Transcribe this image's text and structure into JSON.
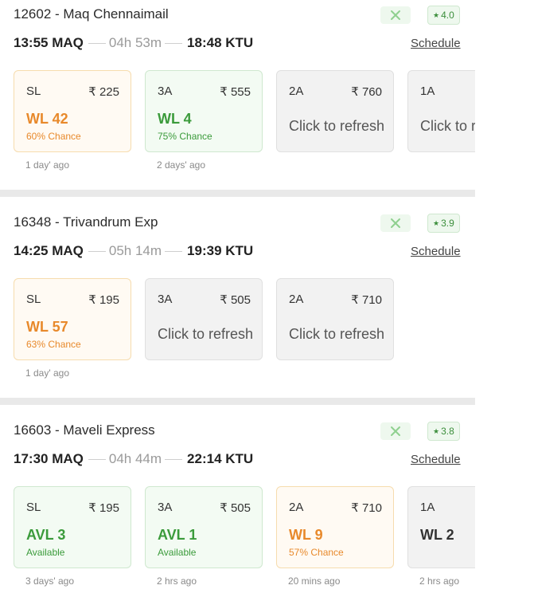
{
  "trains": [
    {
      "number": "12602",
      "name": "Maq Chennaimail",
      "food_icon": "utensils-icon",
      "rating": "4.0",
      "depart": "13:55 MAQ",
      "duration": "04h 53m",
      "arrive": "18:48 KTU",
      "schedule_label": "Schedule",
      "classes": [
        {
          "cls": "SL",
          "price": "₹ 225",
          "status": "WL 42",
          "chance": "60% Chance",
          "kind": "wl",
          "updated": "1 day' ago"
        },
        {
          "cls": "3A",
          "price": "₹ 555",
          "status": "WL 4",
          "chance": "75% Chance",
          "kind": "avl",
          "updated": "2 days' ago"
        },
        {
          "cls": "2A",
          "price": "₹ 760",
          "refresh": "Click to refresh",
          "kind": "neutral",
          "updated": ""
        },
        {
          "cls": "1A",
          "price": "",
          "refresh": "Click to refresh",
          "kind": "neutral",
          "updated": ""
        }
      ]
    },
    {
      "number": "16348",
      "name": "Trivandrum Exp",
      "food_icon": "utensils-icon",
      "rating": "3.9",
      "depart": "14:25 MAQ",
      "duration": "05h 14m",
      "arrive": "19:39 KTU",
      "schedule_label": "Schedule",
      "classes": [
        {
          "cls": "SL",
          "price": "₹ 195",
          "status": "WL 57",
          "chance": "63% Chance",
          "kind": "wl",
          "updated": "1 day' ago"
        },
        {
          "cls": "3A",
          "price": "₹ 505",
          "refresh": "Click to refresh",
          "kind": "neutral",
          "updated": ""
        },
        {
          "cls": "2A",
          "price": "₹ 710",
          "refresh": "Click to refresh",
          "kind": "neutral",
          "updated": ""
        }
      ]
    },
    {
      "number": "16603",
      "name": "Maveli Express",
      "food_icon": "utensils-icon",
      "rating": "3.8",
      "depart": "17:30 MAQ",
      "duration": "04h 44m",
      "arrive": "22:14 KTU",
      "schedule_label": "Schedule",
      "classes": [
        {
          "cls": "SL",
          "price": "₹ 195",
          "status": "AVL 3",
          "chance": "Available",
          "kind": "avl",
          "updated": "3 days' ago"
        },
        {
          "cls": "3A",
          "price": "₹ 505",
          "status": "AVL 1",
          "chance": "Available",
          "kind": "avl",
          "updated": "2 hrs ago"
        },
        {
          "cls": "2A",
          "price": "₹ 710",
          "status": "WL 9",
          "chance": "57% Chance",
          "kind": "wl",
          "updated": "20 mins ago"
        },
        {
          "cls": "1A",
          "price": "",
          "status": "WL 2",
          "chance": "",
          "kind": "neutral",
          "updated": "2 hrs ago"
        }
      ]
    }
  ],
  "colors": {
    "waitlist": "#e8892b",
    "available": "#3b9b3b",
    "separator": "#e9e9e9"
  }
}
